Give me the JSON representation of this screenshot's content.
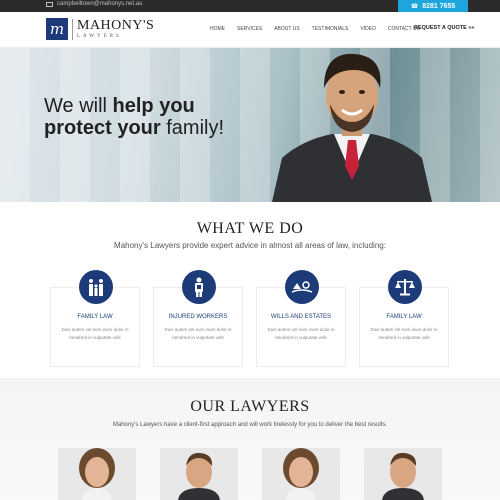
{
  "topbar": {
    "email": "campbelltown@mahonys.net.au",
    "phone": "8281 7655",
    "phone_icon": "phone-icon",
    "email_icon": "envelope-icon"
  },
  "header": {
    "logo_mark": "m",
    "logo_name": "MAHONY'S",
    "logo_sub": "LAWYERS",
    "nav": [
      "HOME",
      "SERVICES",
      "ABOUT US",
      "TESTIMONIALS",
      "VIDEO",
      "CONTACT US"
    ],
    "cta": "REQUEST A QUOTE »»"
  },
  "hero": {
    "line1_pre": "We will ",
    "line1_bold": "help you",
    "line2_bold": "protect your",
    "line2_post": " family!"
  },
  "what_we_do": {
    "title": "WHAT WE DO",
    "subtitle": "Mahony's Lawyers provide expert advice in almost all areas of law, including:",
    "services": [
      {
        "title": "FAMILY LAW",
        "desc": "Duis autem vel eum iriure dolor in hendrerit in vulputate velit",
        "icon": "family-icon"
      },
      {
        "title": "INJURED WORKERS",
        "desc": "Duis autem vel eum iriure dolor in hendrerit in vulputate velit",
        "icon": "injured-worker-icon"
      },
      {
        "title": "WILLS AND ESTATES",
        "desc": "Duis autem vel eum iriure dolor in hendrerit in vulputate velit",
        "icon": "wills-estates-icon"
      },
      {
        "title": "FAMILY LAW",
        "desc": "Duis autem vel eum iriure dolor in hendrerit in vulputate velit",
        "icon": "scales-icon"
      }
    ]
  },
  "lawyers": {
    "title": "OUR LAWYERS",
    "subtitle": "Mahony's Lawyers have a client-first approach and will work tirelessly for you to deliver the best results."
  },
  "colors": {
    "brand": "#1c3b78",
    "accent": "#1ea5dc",
    "dark": "#2b2b2b"
  }
}
